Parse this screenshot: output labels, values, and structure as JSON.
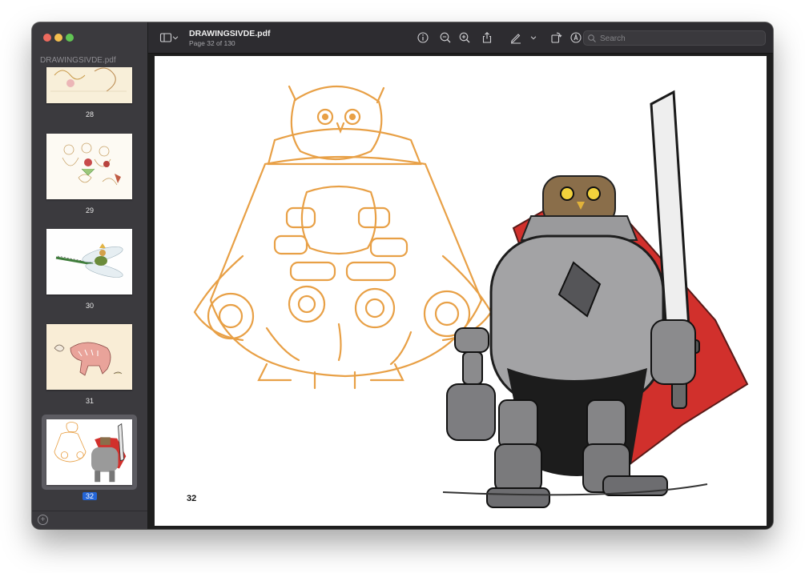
{
  "window": {
    "file_name": "DRAWINGSIVDE.pdf",
    "page_status": "Page 32 of 130"
  },
  "sidebar": {
    "title": "DRAWINGSIVDE.pdf",
    "thumbnails": [
      {
        "label": "28"
      },
      {
        "label": "29"
      },
      {
        "label": "30"
      },
      {
        "label": "31"
      },
      {
        "label": "32",
        "selected": true
      }
    ]
  },
  "toolbar": {
    "search_placeholder": "Search",
    "icons": [
      "sidebar-icon",
      "chevron-down-icon",
      "info-icon",
      "zoom-out-icon",
      "zoom-in-icon",
      "share-icon",
      "markup-pen-icon",
      "chevron-down-icon",
      "rotate-icon",
      "annotate-icon",
      "signature-icon"
    ]
  },
  "page": {
    "number": "32"
  },
  "colors": {
    "sidebar": "#3b3a3e",
    "toolbar": "#2d2c30",
    "selection": "#2465d6",
    "sketch_orange": "#e8a046",
    "cape_red": "#d1302c"
  }
}
